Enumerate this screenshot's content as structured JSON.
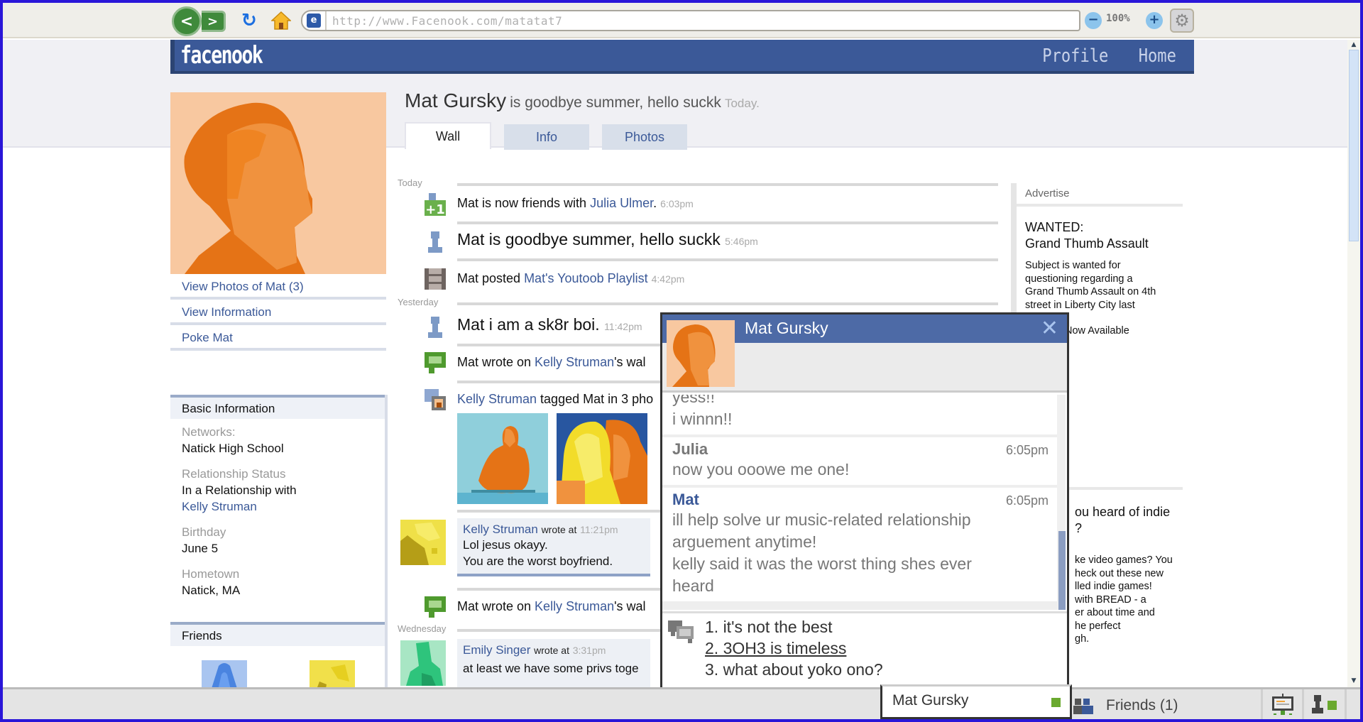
{
  "browser": {
    "url": "http://www.Facenook.com/matatat7",
    "zoom_level": "100%",
    "back_label": "<",
    "forward_label": ">"
  },
  "site": {
    "logo": "facenook",
    "nav": [
      "Profile",
      "Home"
    ]
  },
  "profile": {
    "name": "Mat Gursky",
    "status": "is goodbye summer, hello suckk",
    "status_time": "Today.",
    "tabs": [
      {
        "label": "Wall",
        "active": true
      },
      {
        "label": "Info",
        "active": false
      },
      {
        "label": "Photos",
        "active": false
      }
    ],
    "side_links": [
      "View Photos of Mat (3)",
      "View Information",
      "Poke Mat"
    ]
  },
  "basic_info": {
    "heading": "Basic Information",
    "items": [
      {
        "label": "Networks:",
        "value": "Natick High School"
      },
      {
        "label": "Relationship Status",
        "value": "In a Relationship with",
        "link": "Kelly Struman"
      },
      {
        "label": "Birthday",
        "value": "June 5"
      },
      {
        "label": "Hometown",
        "value": "Natick, MA"
      }
    ],
    "friends_heading": "Friends"
  },
  "feed": {
    "days": [
      "Today",
      "Yesterday",
      "Wednesday"
    ],
    "items": [
      {
        "icon": "add-friend-icon",
        "pre": "Mat is now friends with ",
        "link": "Julia Ulmer",
        "post": ".",
        "time": "6:03pm"
      },
      {
        "icon": "person-icon",
        "pre": "Mat is goodbye summer, hello suckk",
        "time": "5:46pm"
      },
      {
        "icon": "film-icon",
        "pre": "Mat posted ",
        "link": "Mat's Youtoob Playlist",
        "post": "",
        "time": "4:42pm"
      },
      {
        "icon": "person-icon",
        "pre": "Mat i am a sk8r boi.",
        "time": "11:42pm"
      },
      {
        "icon": "wall-post-icon",
        "pre": "Mat wrote on ",
        "link": "Kelly Struman",
        "post": "'s wal"
      },
      {
        "icon": "photo-tag-icon",
        "link": "Kelly Struman",
        "post": " tagged Mat in 3 pho"
      },
      {
        "icon": "wall-post-icon",
        "pre": "Mat wrote on ",
        "link": "Kelly Struman",
        "post": "'s wal"
      }
    ],
    "wall_posts": [
      {
        "author": "Kelly Struman",
        "wrote_at": "wrote at",
        "time": "11:21pm",
        "lines": [
          "Lol jesus okayy.",
          "You are the worst boyfriend."
        ]
      },
      {
        "author": "Emily Singer",
        "wrote_at": "wrote at",
        "time": "3:31pm",
        "lines": [
          "at least we have some privs toge"
        ]
      }
    ]
  },
  "ads": {
    "heading": "Advertise",
    "ad1": {
      "title_lines": [
        "WANTED:",
        "Grand Thumb Assault"
      ],
      "body": [
        "Subject is wanted for",
        "questioning regarding a",
        "Grand Thumb Assault on 4th",
        "street in Liberty City last"
      ],
      "extra": "Now Available"
    },
    "ad2": {
      "title_lines": [
        "ou heard of indie",
        "?"
      ],
      "body": [
        "ke video games? You",
        "heck out these new",
        "lled indie games!",
        "with BREAD - a",
        "er about time and",
        "he perfect",
        "gh."
      ]
    }
  },
  "chat": {
    "title": "Mat Gursky",
    "close_label": "✕",
    "messages": [
      {
        "who": "",
        "time": "",
        "lines": [
          "yess!!",
          "i winnn!!"
        ]
      },
      {
        "who": "Julia",
        "time": "6:05pm",
        "lines": [
          "now you ooowe me one!"
        ]
      },
      {
        "who": "Mat",
        "time": "6:05pm",
        "lines": [
          "ill help solve ur music-related relationship",
          "arguement anytime!",
          "kelly said it was the worst thing shes ever",
          "heard"
        ]
      }
    ],
    "reply_options": [
      "1. it's not the best",
      "2. 3OH3 is timeless",
      "3.  what about yoko ono?"
    ],
    "selected_option": 1
  },
  "bottom_bar": {
    "chat_tab_label": "Mat Gursky",
    "friends_label": "Friends (1)"
  }
}
